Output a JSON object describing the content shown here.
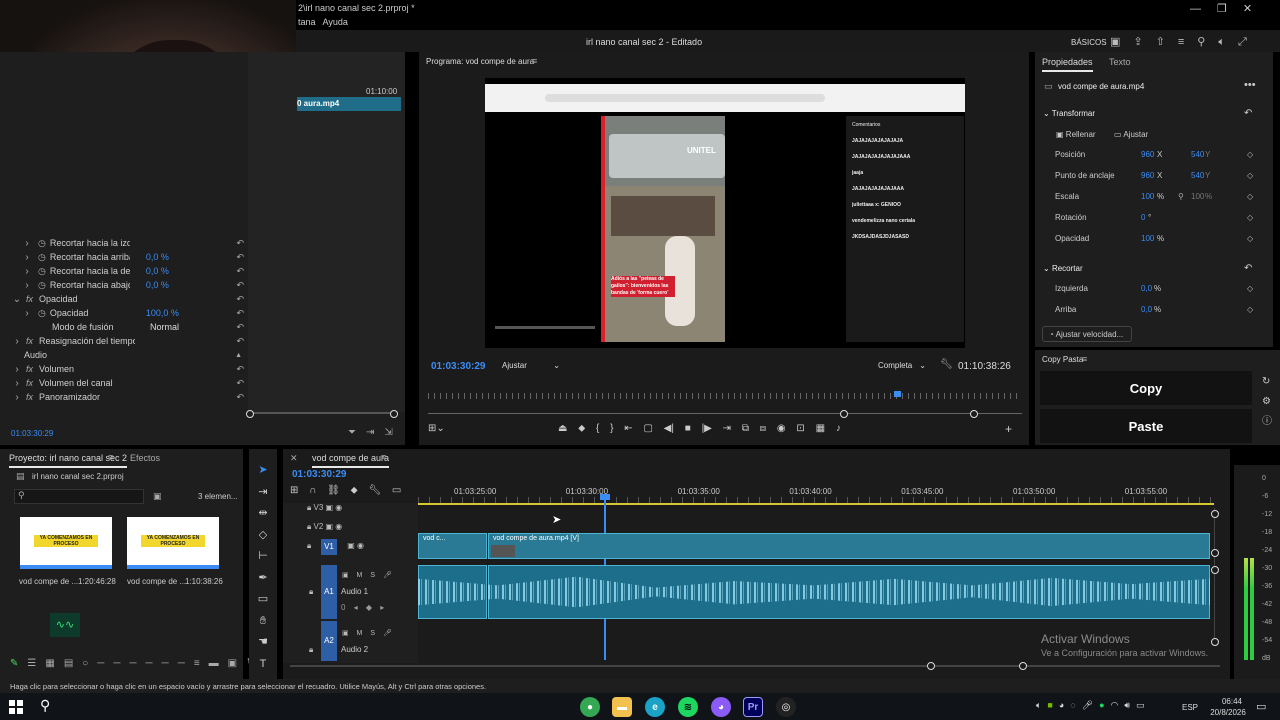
{
  "app": {
    "title": "2\\irl nano canal sec 2.prproj *",
    "project_title": "irl nano canal sec 2 - Editado",
    "menu": [
      "tana",
      "Ayuda"
    ],
    "workspace": "BÁSICOS"
  },
  "effect_controls": {
    "ruler_time": "01:10:00",
    "clip_label": "0 aura.mp4",
    "rows": [
      {
        "label": "Recortar hacia la izqui",
        "value": "",
        "indent": 2
      },
      {
        "label": "Recortar hacia arriba",
        "value": "0,0 %",
        "indent": 2
      },
      {
        "label": "Recortar hacia la dere...",
        "value": "0,0 %",
        "indent": 2
      },
      {
        "label": "Recortar hacia abajo",
        "value": "0,0 %",
        "indent": 2
      },
      {
        "label": "Opacidad",
        "value": "",
        "indent": 1,
        "fx": true
      },
      {
        "label": "Opacidad",
        "value": "100,0 %",
        "indent": 2
      },
      {
        "label": "Modo de fusión",
        "value": "Normal",
        "indent": 3,
        "dropdown": true
      },
      {
        "label": "Reasignación del tiempo",
        "value": "",
        "indent": 1,
        "fx": true
      },
      {
        "label": "Audio",
        "value": "",
        "indent": 0,
        "section": true
      },
      {
        "label": "Volumen",
        "value": "",
        "indent": 1,
        "fx": true
      },
      {
        "label": "Volumen del canal",
        "value": "",
        "indent": 1,
        "fx": true
      },
      {
        "label": "Panoramizador",
        "value": "",
        "indent": 1,
        "fx": true
      }
    ],
    "timecode": "01:03:30:29"
  },
  "program": {
    "title": "Programa: vod compe de aura",
    "timecode": "01:03:30:29",
    "fit": "Ajustar",
    "quality": "Completa",
    "duration": "01:10:38:26",
    "video": {
      "channel": "UNITEL",
      "caption": "Adiós a las \"peleas de gallos\": bienvenidos las bandas de 'forma cuero'",
      "chat_header": "Comentarios",
      "chat": [
        "JAJAJAJAJAJAJAJA",
        "JAJAJAJAJAJAJAJAAA",
        "jaaja",
        "JAJAJAJAJAJAJAAA",
        "juliettaaa x: GENIOO",
        "vendemelizza nano certala",
        "JKDSAJDASJDJASASD"
      ]
    }
  },
  "properties": {
    "tabs": [
      "Propiedades",
      "Texto"
    ],
    "clip": "vod compe de aura.mp4",
    "transform_header": "Transformar",
    "fill": "Rellenar",
    "fit": "Ajustar",
    "props": [
      {
        "label": "Posición",
        "v1": "960",
        "u1": "X",
        "v2": "540",
        "u2": "Y"
      },
      {
        "label": "Punto de anclaje",
        "v1": "960",
        "u1": "X",
        "v2": "540",
        "u2": "Y"
      },
      {
        "label": "Escala",
        "v1": "100",
        "u1": "%",
        "v2": "100",
        "u2": "%"
      },
      {
        "label": "Rotación",
        "v1": "0",
        "u1": "°",
        "v2": "",
        "u2": ""
      },
      {
        "label": "Opacidad",
        "v1": "100",
        "u1": "%",
        "v2": "",
        "u2": ""
      }
    ],
    "crop_header": "Recortar",
    "crop": [
      {
        "label": "Izquierda",
        "v1": "0,0",
        "u1": "%"
      },
      {
        "label": "Arriba",
        "v1": "0,0",
        "u1": "%"
      }
    ],
    "speed_button": "Ajustar velocidad..."
  },
  "copypaste": {
    "title": "Copy Pasta",
    "copy": "Copy",
    "paste": "Paste"
  },
  "project": {
    "tabs": [
      "Proyecto: irl nano canal sec 2",
      "Efectos"
    ],
    "file": "irl nano canal sec 2.prproj",
    "count": "3 elemen...",
    "bin_text": "YA COMENZAMOS EN PROCESO",
    "items": [
      {
        "name": "vod compe de ...",
        "duration": "1:20:46:28"
      },
      {
        "name": "vod compe de ...",
        "duration": "1:10:38:26"
      }
    ]
  },
  "timeline": {
    "title": "vod compe de aura",
    "timecode": "01:03:30:29",
    "ruler": [
      "01:03:25:00",
      "01:03:30:00",
      "01:03:35:00",
      "01:03:40:00",
      "01:03:45:00",
      "01:03:50:00",
      "01:03:55:00"
    ],
    "tracks": {
      "v3": "V3",
      "v2": "V2",
      "v1": "V1",
      "a1": "A1",
      "a2": "A2",
      "audio1": "Audio 1",
      "audio2": "Audio 2"
    },
    "clip_prev": "vod c...",
    "clip_main": "vod compe de aura.mp4 [V]",
    "meter_labels": [
      "0",
      "-6",
      "-12",
      "-18",
      "-24",
      "-30",
      "-36",
      "-42",
      "-48",
      "-54",
      "dB"
    ],
    "meter_level_db": -24
  },
  "status": "Haga clic para seleccionar o haga clic en un espacio vacío y arrastre para seleccionar el recuadro. Utilice Mayús, Alt y Ctrl para otras opciones.",
  "watermark": {
    "line1": "Activar Windows",
    "line2": "Ve a Configuración para activar Windows."
  },
  "taskbar": {
    "lang": "ESP",
    "time": "06:44",
    "date": "20/8/2026"
  }
}
